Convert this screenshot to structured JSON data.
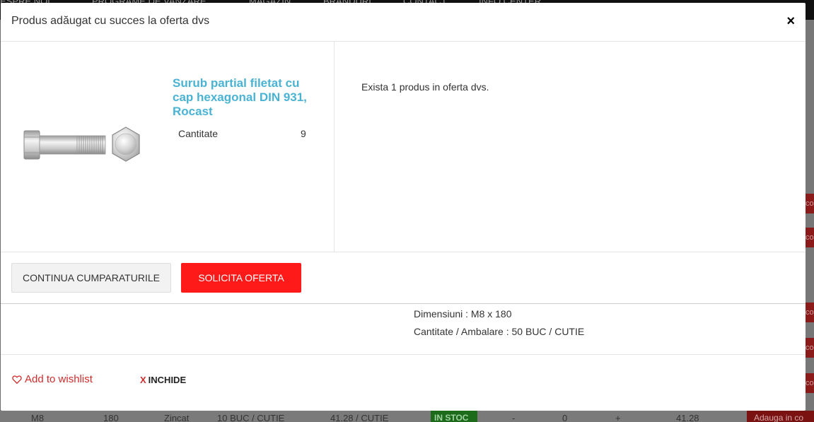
{
  "background": {
    "nav_items": [
      "ESPRE NOI",
      "PROGRAME DE VANZARE",
      "MAGAZIN",
      "BRANDURI",
      "CONTACT",
      "INFO CENTER"
    ],
    "side_label": "cos",
    "bottom_row": {
      "cells": [
        "M8",
        "180",
        "Zincat",
        "10 BUC / CUTIE",
        "41.28 / CUTIE",
        "IN STOC",
        "-",
        "0",
        "+",
        "41.28",
        "Adauga in co"
      ]
    }
  },
  "modal": {
    "title": "Produs adăugat cu succes la oferta dvs",
    "close_label": "×",
    "product": {
      "image_icon": "hex-bolt-image",
      "name": "Surub partial filetat cu cap hexagonal DIN 931, Rocast",
      "quantity_label": "Cantitate",
      "quantity_value": "9"
    },
    "cart_info": "Exista 1 produs in oferta dvs.",
    "buttons": {
      "continue": "CONTINUA CUMPARATURILE",
      "request_offer": "SOLICITA OFERTA"
    },
    "specs": {
      "dimensions": "Dimensiuni : M8 x 180",
      "packaging": "Cantitate / Ambalare : 50 BUC / CUTIE"
    },
    "footer": {
      "wishlist": "Add to wishlist",
      "close_x": "X",
      "close_label": "INCHIDE"
    }
  },
  "colors": {
    "accent_red": "#ff1a1a",
    "product_link": "#4ab3d4",
    "wishlist_red": "#d02c2c"
  }
}
